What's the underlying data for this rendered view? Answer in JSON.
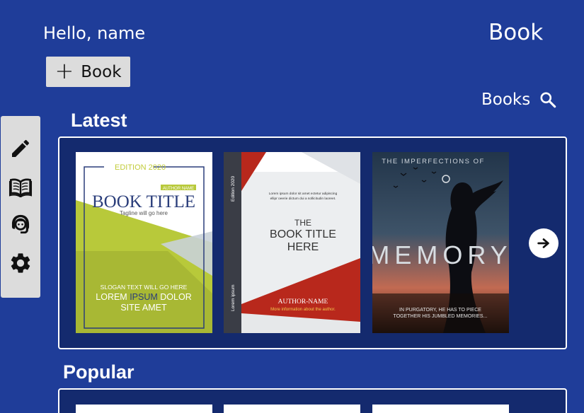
{
  "header": {
    "greeting": "Hello, name",
    "app_title": "Book",
    "add_button_label": "Book",
    "books_link_label": "Books"
  },
  "sections": {
    "latest_title": "Latest",
    "popular_title": "Popular"
  },
  "sidebar": {
    "items": [
      {
        "icon": "pencil-icon"
      },
      {
        "icon": "open-book-icon"
      },
      {
        "icon": "support-agent-icon"
      },
      {
        "icon": "gear-icon"
      }
    ]
  },
  "latest_books": [
    {
      "edition": "EDITION 2020",
      "author_tag": "AUTHOR NAME",
      "title": "BOOK TITLE",
      "tagline": "Tagline will go here",
      "slogan": "SLOGAN TEXT WILL GO HERE",
      "lorem_line1_a": "LOREM",
      "lorem_line1_b": "IPSUM",
      "lorem_line1_c": "DOLOR",
      "lorem_line2": "SITE AMET"
    },
    {
      "edition_side": "Edition 2020",
      "spine_text": "Lorem ipsum",
      "blurb_line1": "Lorem ipsum dolor sit amet ectetur adipiscing",
      "blurb_line2": "ellipr oeerie dictum dui a sollicitudin laoreet.",
      "title_line1": "THE",
      "title_line2": "BOOK TITLE",
      "title_line3": "HERE",
      "author": "AUTHOR-NAME",
      "author_note": "More information about the author."
    },
    {
      "top_line": "THE IMPERFECTIONS OF",
      "title": "MEMORY",
      "tagline_line1": "IN PURGATORY, HE HAS TO PIECE",
      "tagline_line2": "TOGETHER HIS JUMBLED MEMORIES..."
    }
  ],
  "colors": {
    "background": "#1f3d99",
    "panel": "#142a6e",
    "sidebar": "#dcdcdc"
  }
}
